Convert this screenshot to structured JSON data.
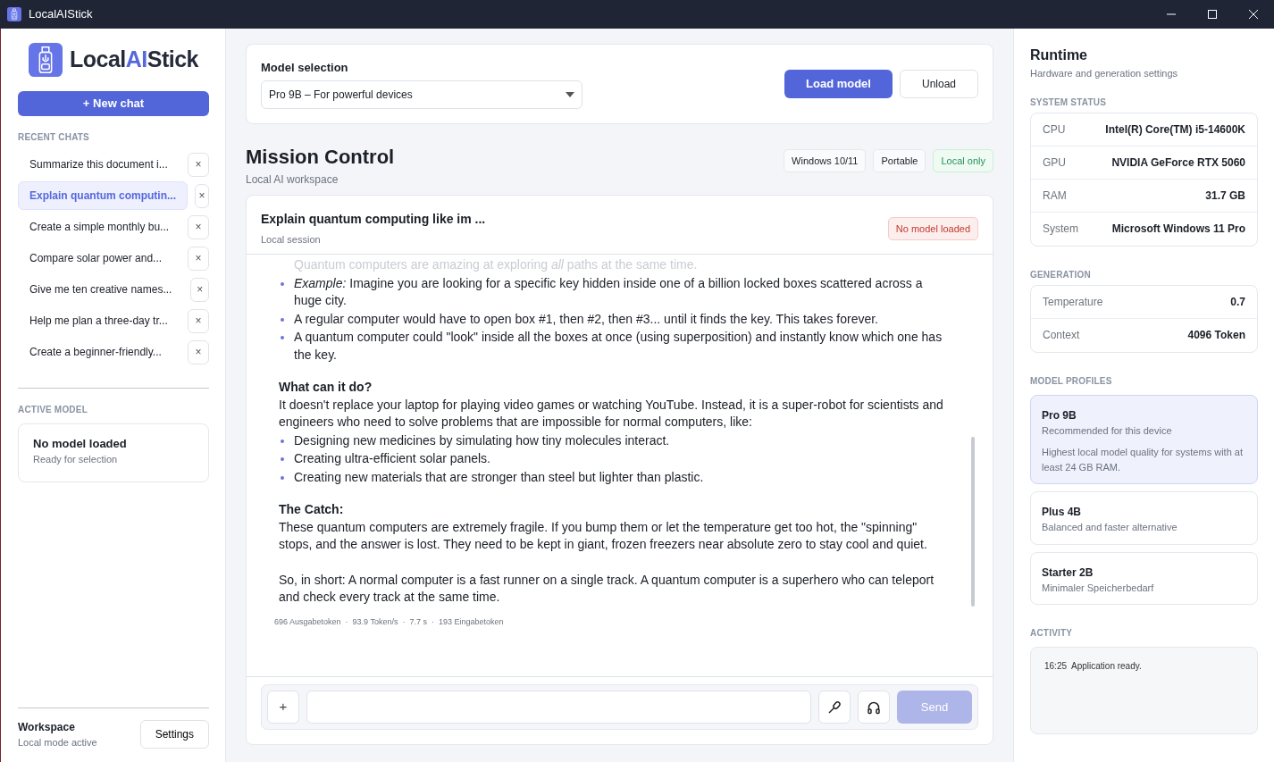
{
  "window": {
    "title": "LocalAIStick"
  },
  "sidebar": {
    "brand_parts": [
      {
        "text": "Local",
        "accent": false
      },
      {
        "text": "AI",
        "accent": true
      },
      {
        "text": "Stick",
        "accent": false
      }
    ],
    "new_chat": "+ New chat",
    "recent_label": "RECENT CHATS",
    "chats": [
      {
        "title": "Summarize this document i...",
        "selected": false,
        "delete": "×"
      },
      {
        "title": "Explain quantum computin...",
        "selected": true,
        "delete": "×"
      },
      {
        "title": "Create a simple monthly bu...",
        "selected": false,
        "delete": "×"
      },
      {
        "title": "Compare solar power and...",
        "selected": false,
        "delete": "×"
      },
      {
        "title": "Give me ten creative names...",
        "selected": false,
        "delete": "×"
      },
      {
        "title": "Help me plan a three-day tr...",
        "selected": false,
        "delete": "×"
      },
      {
        "title": "Create a beginner-friendly...",
        "selected": false,
        "delete": "×"
      }
    ],
    "active_model_label": "ACTIVE MODEL",
    "active_model": {
      "title": "No model loaded",
      "subtitle": "Ready for selection"
    },
    "workspace": {
      "title": "Workspace",
      "subtitle": "Local mode active",
      "button": "Settings"
    }
  },
  "model_selection": {
    "label": "Model selection",
    "value": "Pro 9B – For powerful devices",
    "load": "Load model",
    "unload": "Unload"
  },
  "header": {
    "title": "Mission Control",
    "subtitle": "Local AI workspace",
    "badges": [
      {
        "text": "Windows 10/11",
        "kind": "neutral"
      },
      {
        "text": "Portable",
        "kind": "neutral"
      },
      {
        "text": "Local only",
        "kind": "success"
      }
    ]
  },
  "chat": {
    "title": "Explain quantum computing like im ...",
    "subtitle": "Local session",
    "status": {
      "text": "No model loaded",
      "kind": "danger"
    },
    "blocks": [
      {
        "kind": "faded",
        "text": "Quantum computers are amazing at exploring *all* paths at the same time."
      },
      {
        "kind": "bullet",
        "text": "*Example:* Imagine you are looking for a specific key hidden inside one of a billion locked boxes scattered across a huge city."
      },
      {
        "kind": "bullet",
        "text": "A regular computer would have to open box #1, then #2, then #3... until it finds the key. This takes forever."
      },
      {
        "kind": "bullet",
        "text": "A quantum computer could \"look\" inside all the boxes at once (using superposition) and instantly know which one has the key."
      },
      {
        "kind": "heading",
        "text": "What can it do?"
      },
      {
        "kind": "paragraph",
        "text": "It doesn't replace your laptop for playing video games or watching YouTube. Instead, it is a super-robot for scientists and engineers who need to solve problems that are impossible for normal computers, like:"
      },
      {
        "kind": "bullet",
        "text": "Designing new medicines by simulating how tiny molecules interact."
      },
      {
        "kind": "bullet",
        "text": "Creating ultra-efficient solar panels."
      },
      {
        "kind": "bullet",
        "text": "Creating new materials that are stronger than steel but lighter than plastic."
      },
      {
        "kind": "heading",
        "text": "The Catch:"
      },
      {
        "kind": "paragraph",
        "text": "These quantum computers are extremely fragile. If you bump them or let the temperature get too hot, the \"spinning\" stops, and the answer is lost. They need to be kept in giant, frozen freezers near absolute zero to stay cool and quiet."
      },
      {
        "kind": "paragraph",
        "text": "So, in short: A normal computer is a fast runner on a single track. A quantum computer is a superhero who can teleport and check every track at the same time."
      }
    ],
    "stats": "696 Ausgabetoken  ·  93.9 Token/s  ·  7.7 s  ·  193 Eingabetoken",
    "composer": {
      "attach": "+",
      "send": "Send",
      "send_disabled": true
    }
  },
  "runtime": {
    "title": "Runtime",
    "subtitle": "Hardware and generation settings",
    "system_label": "SYSTEM STATUS",
    "system": [
      {
        "key": "CPU",
        "value": "Intel(R) Core(TM) i5-14600K"
      },
      {
        "key": "GPU",
        "value": "NVIDIA GeForce RTX 5060"
      },
      {
        "key": "RAM",
        "value": "31.7 GB"
      },
      {
        "key": "System",
        "value": "Microsoft Windows 11 Pro"
      }
    ],
    "generation_label": "GENERATION",
    "generation": [
      {
        "key": "Temperature",
        "value": "0.7"
      },
      {
        "key": "Context",
        "value": "4096 Token"
      }
    ],
    "profiles_label": "MODEL PROFILES",
    "profiles": [
      {
        "name": "Pro 9B",
        "subtitle": "Recommended for this device",
        "description": "Highest local model quality for systems with at least 24 GB RAM.",
        "selected": true
      },
      {
        "name": "Plus 4B",
        "subtitle": "Balanced and faster alternative",
        "selected": false
      },
      {
        "name": "Starter 2B",
        "subtitle": "Minimaler Speicherbedarf",
        "selected": false
      }
    ],
    "activity_label": "ACTIVITY",
    "activity": [
      {
        "time": "16:25",
        "text": "Application ready."
      }
    ]
  }
}
